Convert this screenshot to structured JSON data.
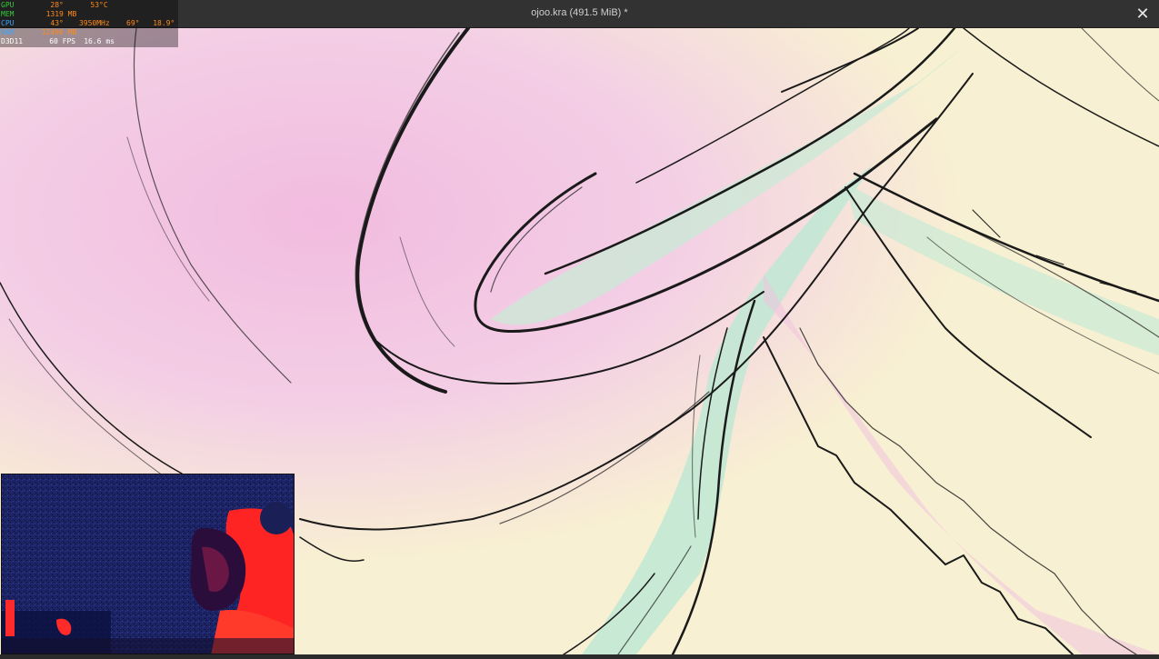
{
  "window": {
    "title": "ojoo.kra (491.5 MiB) *",
    "close_label": "✕"
  },
  "overlay": {
    "rows": [
      {
        "label": "GPU",
        "v1": "28°",
        "v2": "53°C",
        "label_color": "#36c93a",
        "value_color": "#ff8a1a"
      },
      {
        "label": "MEM",
        "v1": "1319",
        "v2": "MB",
        "label_color": "#36c93a",
        "value_color": "#ff8a1a"
      },
      {
        "label": "CPU",
        "v1": "43°",
        "v2": "3950MHz",
        "v3": "69°",
        "v4": "18.9°",
        "label_color": "#3aa3ff",
        "value_color": "#ff8a1a"
      },
      {
        "label": "RAM",
        "v1": "12496",
        "v2": "MB",
        "label_color": "#3aa3ff",
        "value_color": "#ff8a1a"
      },
      {
        "label": "D3D11",
        "v1": "60",
        "v2": "FPS",
        "v3": "16.6",
        "v4": "ms",
        "label_color": "#ffffff",
        "value_color": "#ffffff"
      }
    ]
  },
  "canvas": {
    "colors": {
      "paper": "#f8f0d2",
      "pink": "#f3c6e6",
      "mint": "#c6ecd9",
      "ink": "#1a1a1a"
    }
  },
  "webcam": {
    "colors": {
      "bg": "#1b1f5a",
      "hot": "#ff2a2a"
    }
  }
}
